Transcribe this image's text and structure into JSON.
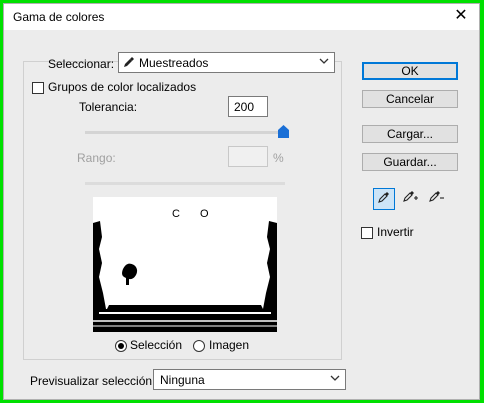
{
  "window": {
    "title": "Gama de colores",
    "close_glyph": "✕"
  },
  "select_row": {
    "label": "Seleccionar:",
    "value": "Muestreados",
    "icon": "eyedropper-icon"
  },
  "localized": {
    "label": "Grupos de color localizados",
    "checked": false
  },
  "tolerance": {
    "label": "Tolerancia:",
    "value": "200",
    "slider_fraction": 1.0
  },
  "range": {
    "label": "Rango:",
    "value": "",
    "unit": "%"
  },
  "view": {
    "selection_label": "Selección",
    "image_label": "Imagen",
    "selected": "selection"
  },
  "preview_select": {
    "label": "Previsualizar selección:",
    "value": "Ninguna"
  },
  "buttons": {
    "ok": "OK",
    "cancel": "Cancelar",
    "load": "Cargar...",
    "save": "Guardar..."
  },
  "invert": {
    "label": "Invertir",
    "checked": false
  },
  "tools": [
    "eyedropper-icon",
    "eyedropper-plus-icon",
    "eyedropper-minus-icon"
  ],
  "colors": {
    "accent": "#0078d7",
    "background": "#00e000",
    "slider_thumb": "#1a6fd6"
  }
}
